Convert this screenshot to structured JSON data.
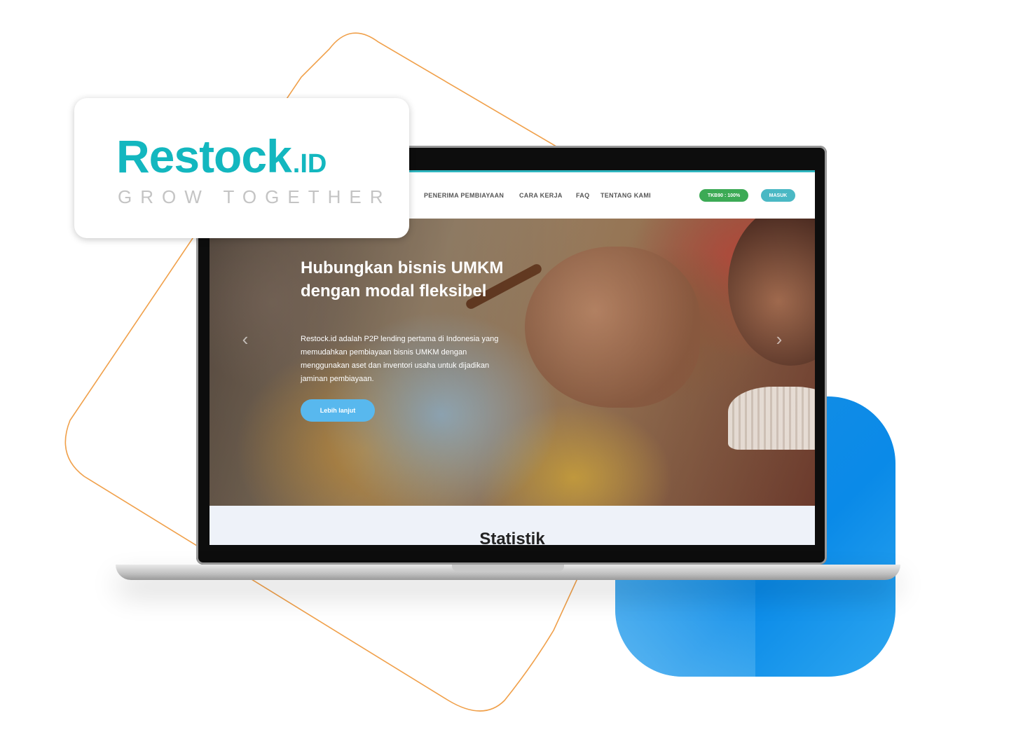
{
  "brand": {
    "name": "Restock",
    "suffix": ".ID",
    "tagline": "GROW TOGETHER"
  },
  "nav": {
    "items": [
      {
        "label": "PENERIMA PEMBIAYAAN"
      },
      {
        "label": "CARA KERJA"
      },
      {
        "label": "FAQ"
      },
      {
        "label": "TENTANG KAMI"
      }
    ],
    "tkb_label": "TKB90 : 100%",
    "login_label": "MASUK"
  },
  "hero": {
    "title": "Hubungkan bisnis UMKM dengan modal fleksibel",
    "description": "Restock.id adalah P2P lending pertama di Indonesia yang memudahkan pembiayaan bisnis UMKM dengan menggunakan aset dan inventori usaha untuk dijadikan jaminan pembiayaan.",
    "cta_label": "Lebih lanjut",
    "prev_icon": "chevron-left-icon",
    "next_icon": "chevron-right-icon"
  },
  "stats": {
    "title": "Statistik"
  },
  "colors": {
    "brand_teal": "#13b7bf",
    "tkb_green": "#3caa55",
    "login_teal": "#4ab8c4",
    "cta_blue": "#58b8ee",
    "accent_blue": "#1a8fe3",
    "outline_orange": "#f0a04a"
  }
}
